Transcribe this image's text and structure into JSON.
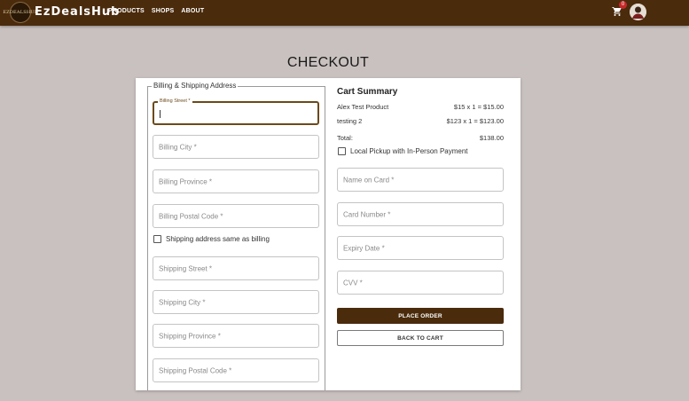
{
  "nav": {
    "brand": "EzDealsHub",
    "logo_text": "EZDEALSHUB",
    "links": [
      "PRODUCTS",
      "SHOPS",
      "ABOUT"
    ],
    "cart_count": "0",
    "cart_icon": "cart-icon",
    "avatar_icon": "user-avatar",
    "bar_color": "#4a2b0c"
  },
  "page": {
    "title": "CHECKOUT"
  },
  "billing": {
    "legend": "Billing & Shipping Address",
    "street_label": "Billing Street *",
    "city_placeholder": "Billing City *",
    "province_placeholder": "Billing Province *",
    "postal_placeholder": "Billing Postal Code *",
    "same_as_billing_label": "Shipping address same as billing",
    "shipping_street_placeholder": "Shipping Street *",
    "shipping_city_placeholder": "Shipping City *",
    "shipping_province_placeholder": "Shipping Province *",
    "shipping_postal_placeholder": "Shipping Postal Code *"
  },
  "cart": {
    "title": "Cart Summary",
    "items": [
      {
        "name": "Alex Test Product",
        "price": "$15 x 1 = $15.00"
      },
      {
        "name": "testing 2",
        "price": "$123 x 1 = $123.00"
      }
    ],
    "total_label": "Total:",
    "total_value": "$138.00",
    "pickup_label": "Local Pickup with In-Person Payment",
    "name_on_card_placeholder": "Name on Card *",
    "card_number_placeholder": "Card Number *",
    "expiry_placeholder": "Expiry Date *",
    "cvv_placeholder": "CVV *",
    "place_order_label": "PLACE ORDER",
    "back_to_cart_label": "BACK TO CART"
  }
}
